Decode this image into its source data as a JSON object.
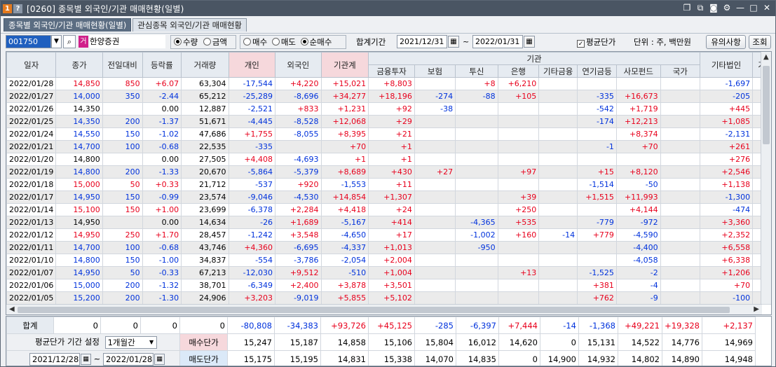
{
  "window": {
    "num_badge": "1",
    "help_badge": "?",
    "title": "[0260] 종목별 외국인/기관 매매현황(일별)",
    "icons": [
      "restore-icon",
      "copy-icon",
      "camera-icon",
      "gear-icon",
      "minimize-icon",
      "maximize-icon",
      "close-icon"
    ]
  },
  "tabs": [
    {
      "label": "종목별 외국인/기관 매매현황(일별)",
      "active": true
    },
    {
      "label": "관심종목 외국인/기관 매매현황",
      "active": false
    }
  ],
  "toolbar": {
    "stock_code": "001750",
    "stock_badge": "거",
    "stock_name": "한양증권",
    "unit_options": [
      {
        "label": "수량",
        "selected": true
      },
      {
        "label": "금액",
        "selected": false
      }
    ],
    "side_options": [
      {
        "label": "매수",
        "selected": false
      },
      {
        "label": "매도",
        "selected": false
      },
      {
        "label": "순매수",
        "selected": true
      }
    ],
    "period_label": "합계기간",
    "start_date": "2021/12/31",
    "tilde": "~",
    "end_date": "2022/01/31",
    "avg_price_label": "평균단가",
    "avg_price_checked": true,
    "unit_text": "단위 : 주, 백만원",
    "notice_button": "유의사항",
    "query_button": "조회"
  },
  "grid": {
    "headers": {
      "date": "일자",
      "price": "종가",
      "change": "전일대비",
      "rate": "등락률",
      "volume": "거래량",
      "individual": "개인",
      "foreign": "외국인",
      "inst_total": "기관계",
      "inst_group": "기관",
      "finance": "금융투자",
      "insurance": "보험",
      "trust": "투신",
      "bank": "은행",
      "other_fin": "기타금융",
      "pension": "연기금등",
      "private_fund": "사모펀드",
      "nation": "국가",
      "other_corp": "기타법인",
      "extra": "기"
    },
    "rows": [
      [
        "2022/01/28",
        "14,850",
        "850",
        "+6.07",
        "63,304",
        "-17,544",
        "+4,220",
        "+15,021",
        "+8,803",
        "",
        "+8",
        "+6,210",
        "",
        "",
        "",
        "",
        "-1,697"
      ],
      [
        "2022/01/27",
        "14,000",
        "350",
        "-2.44",
        "65,212",
        "-25,289",
        "-8,696",
        "+34,277",
        "+18,196",
        "-274",
        "-88",
        "+105",
        "",
        "-335",
        "+16,673",
        "",
        "-205"
      ],
      [
        "2022/01/26",
        "14,350",
        "",
        "0.00",
        "12,887",
        "-2,521",
        "+833",
        "+1,231",
        "+92",
        "-38",
        "",
        "",
        "",
        "-542",
        "+1,719",
        "",
        "+445"
      ],
      [
        "2022/01/25",
        "14,350",
        "200",
        "-1.37",
        "51,671",
        "-4,445",
        "-8,528",
        "+12,068",
        "+29",
        "",
        "",
        "",
        "",
        "-174",
        "+12,213",
        "",
        "+1,085"
      ],
      [
        "2022/01/24",
        "14,550",
        "150",
        "-1.02",
        "47,686",
        "+1,755",
        "-8,055",
        "+8,395",
        "+21",
        "",
        "",
        "",
        "",
        "",
        "+8,374",
        "",
        "-2,131"
      ],
      [
        "2022/01/21",
        "14,700",
        "100",
        "-0.68",
        "22,535",
        "-335",
        "",
        "+70",
        "+1",
        "",
        "",
        "",
        "",
        "-1",
        "+70",
        "",
        "+261"
      ],
      [
        "2022/01/20",
        "14,800",
        "",
        "0.00",
        "27,505",
        "+4,408",
        "-4,693",
        "+1",
        "+1",
        "",
        "",
        "",
        "",
        "",
        "",
        "",
        "+276"
      ],
      [
        "2022/01/19",
        "14,800",
        "200",
        "-1.33",
        "20,670",
        "-5,864",
        "-5,379",
        "+8,689",
        "+430",
        "+27",
        "",
        "+97",
        "",
        "+15",
        "+8,120",
        "",
        "+2,546"
      ],
      [
        "2022/01/18",
        "15,000",
        "50",
        "+0.33",
        "21,712",
        "-537",
        "+920",
        "-1,553",
        "+11",
        "",
        "",
        "",
        "",
        "-1,514",
        "-50",
        "",
        "+1,138"
      ],
      [
        "2022/01/17",
        "14,950",
        "150",
        "-0.99",
        "23,574",
        "-9,046",
        "-4,530",
        "+14,854",
        "+1,307",
        "",
        "",
        "+39",
        "",
        "+1,515",
        "+11,993",
        "",
        "-1,300"
      ],
      [
        "2022/01/14",
        "15,100",
        "150",
        "+1.00",
        "23,699",
        "-6,378",
        "+2,284",
        "+4,418",
        "+24",
        "",
        "",
        "+250",
        "",
        "",
        "+4,144",
        "",
        "-474"
      ],
      [
        "2022/01/13",
        "14,950",
        "",
        "0.00",
        "14,634",
        "-26",
        "+1,689",
        "-5,167",
        "+414",
        "",
        "-4,365",
        "+535",
        "",
        "-779",
        "-972",
        "",
        "+3,360"
      ],
      [
        "2022/01/12",
        "14,950",
        "250",
        "+1.70",
        "28,457",
        "-1,242",
        "+3,548",
        "-4,650",
        "+17",
        "",
        "-1,002",
        "+160",
        "-14",
        "+779",
        "-4,590",
        "",
        "+2,352"
      ],
      [
        "2022/01/11",
        "14,700",
        "100",
        "-0.68",
        "43,746",
        "+4,360",
        "-6,695",
        "-4,337",
        "+1,013",
        "",
        "-950",
        "",
        "",
        "",
        "-4,400",
        "",
        "+6,558"
      ],
      [
        "2022/01/10",
        "14,800",
        "150",
        "-1.00",
        "34,837",
        "-554",
        "-3,786",
        "-2,054",
        "+2,004",
        "",
        "",
        "",
        "",
        "",
        "-4,058",
        "",
        "+6,338"
      ],
      [
        "2022/01/07",
        "14,950",
        "50",
        "-0.33",
        "67,213",
        "-12,030",
        "+9,512",
        "-510",
        "+1,004",
        "",
        "",
        "+13",
        "",
        "-1,525",
        "-2",
        "",
        "+1,206"
      ],
      [
        "2022/01/06",
        "15,000",
        "200",
        "-1.32",
        "38,701",
        "-6,349",
        "+2,400",
        "+3,878",
        "+3,501",
        "",
        "",
        "",
        "",
        "+381",
        "-4",
        "",
        "+70"
      ],
      [
        "2022/01/05",
        "15,200",
        "200",
        "-1.30",
        "24,906",
        "+3,203",
        "-9,019",
        "+5,855",
        "+5,102",
        "",
        "",
        "",
        "",
        "+762",
        "-9",
        "",
        "-100"
      ]
    ]
  },
  "summary": {
    "total_label": "합계",
    "totals": [
      "0",
      "0",
      "0",
      "0",
      "-80,808",
      "-34,383",
      "+93,726",
      "+45,125",
      "-285",
      "-6,397",
      "+7,444",
      "-14",
      "-1,368",
      "+49,221",
      "+19,328",
      "+2,137"
    ],
    "avg_period_label": "평균단가 기간 설정",
    "avg_period_value": "1개월간",
    "avg_start": "2021/12/28",
    "avg_tilde": "~",
    "avg_end": "2022/01/28",
    "buy_label": "매수단가",
    "buy_values": [
      "15,247",
      "15,187",
      "14,858",
      "15,106",
      "15,804",
      "16,012",
      "14,620",
      "0",
      "15,131",
      "14,522",
      "14,776",
      "14,969"
    ],
    "sell_label": "매도단가",
    "sell_values": [
      "15,175",
      "15,195",
      "14,831",
      "15,338",
      "14,070",
      "14,835",
      "0",
      "14,900",
      "14,932",
      "14,802",
      "14,890",
      "14,948"
    ]
  },
  "colors": {
    "up": "#e8001c",
    "down": "#0032dc",
    "title_bar": "#4a5563",
    "header": "#e6ebf1",
    "pink_header": "#f6d8dc"
  }
}
